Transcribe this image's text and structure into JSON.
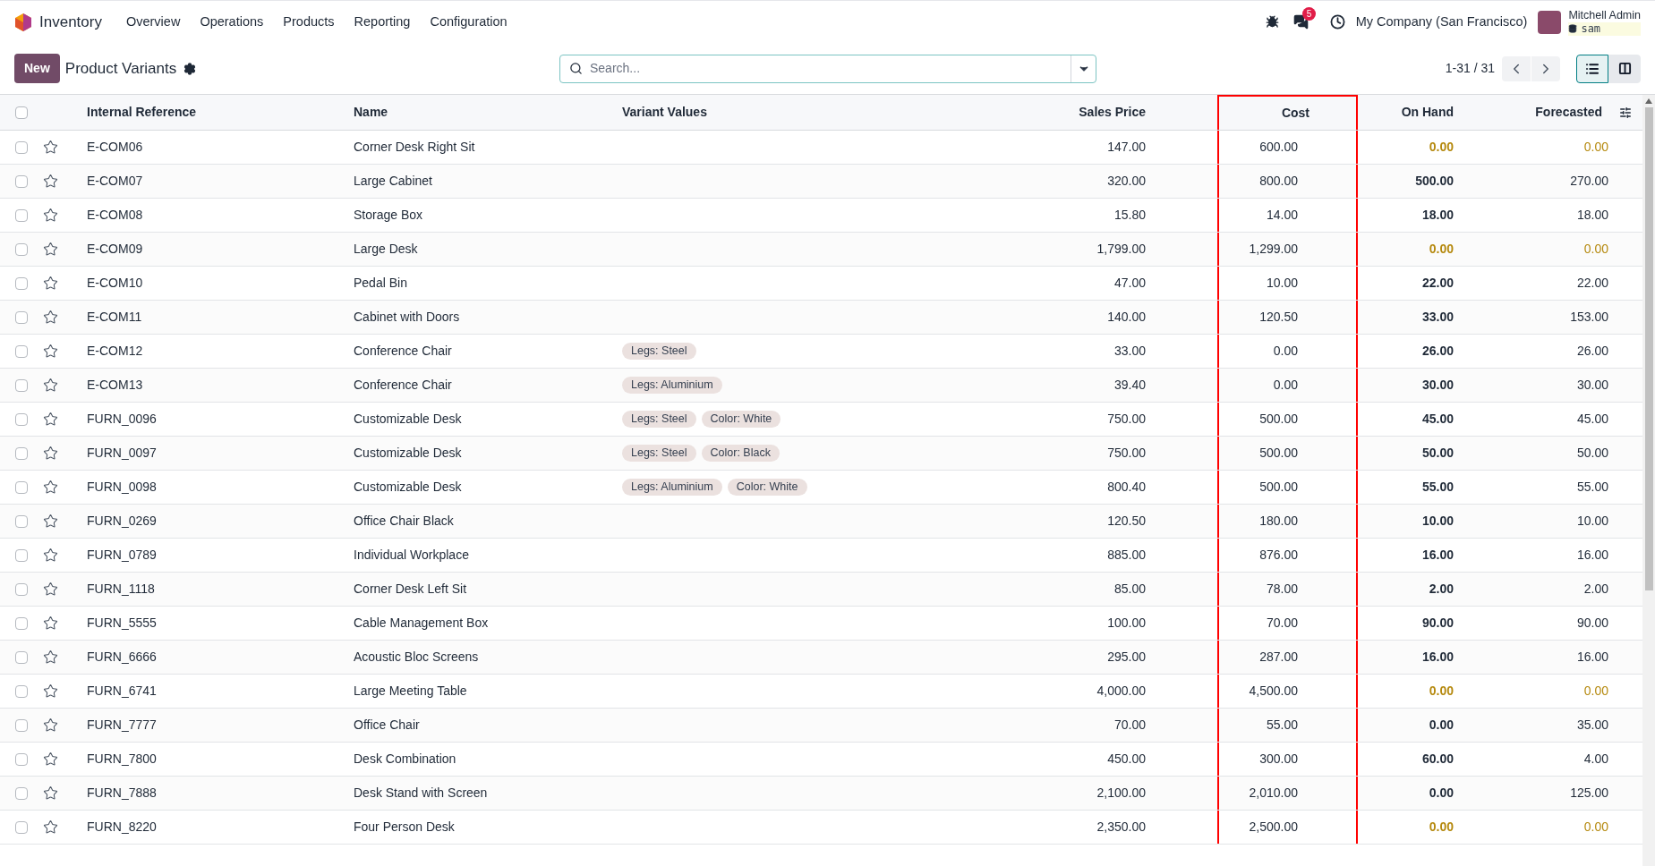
{
  "navbar": {
    "app": "Inventory",
    "menu": [
      "Overview",
      "Operations",
      "Products",
      "Reporting",
      "Configuration"
    ],
    "messages_badge": "5",
    "company": "My Company (San Francisco)",
    "user": "Mitchell Admin",
    "database": "sam"
  },
  "control_panel": {
    "new_button": "New",
    "title": "Product Variants",
    "search": {
      "placeholder": "Search..."
    },
    "pager": "1-31 / 31",
    "views": [
      {
        "kind": "list",
        "selected": true
      },
      {
        "kind": "kanban",
        "selected": false
      }
    ]
  },
  "table": {
    "select_all_checked": false,
    "columns": [
      {
        "label": "Internal Reference",
        "highlighted": false
      },
      {
        "label": "Name",
        "highlighted": false
      },
      {
        "label": "Variant Values",
        "highlighted": false
      },
      {
        "label": "Sales Price",
        "highlighted": false
      },
      {
        "label": "Cost",
        "highlighted": true
      },
      {
        "label": "On Hand",
        "highlighted": false
      },
      {
        "label": "Forecasted",
        "highlighted": false
      }
    ],
    "rows": [
      {
        "checked": false,
        "ref": "E-COM06",
        "name": "Corner Desk Right Sit",
        "variants": [],
        "sales_price": "147.00",
        "cost": "600.00",
        "on_hand": "0.00",
        "forecasted": "0.00",
        "warning": true
      },
      {
        "checked": false,
        "ref": "E-COM07",
        "name": "Large Cabinet",
        "variants": [],
        "sales_price": "320.00",
        "cost": "800.00",
        "on_hand": "500.00",
        "forecasted": "270.00",
        "warning": false
      },
      {
        "checked": false,
        "ref": "E-COM08",
        "name": "Storage Box",
        "variants": [],
        "sales_price": "15.80",
        "cost": "14.00",
        "on_hand": "18.00",
        "forecasted": "18.00",
        "warning": false
      },
      {
        "checked": false,
        "ref": "E-COM09",
        "name": "Large Desk",
        "variants": [],
        "sales_price": "1,799.00",
        "cost": "1,299.00",
        "on_hand": "0.00",
        "forecasted": "0.00",
        "warning": true
      },
      {
        "checked": false,
        "ref": "E-COM10",
        "name": "Pedal Bin",
        "variants": [],
        "sales_price": "47.00",
        "cost": "10.00",
        "on_hand": "22.00",
        "forecasted": "22.00",
        "warning": false
      },
      {
        "checked": false,
        "ref": "E-COM11",
        "name": "Cabinet with Doors",
        "variants": [],
        "sales_price": "140.00",
        "cost": "120.50",
        "on_hand": "33.00",
        "forecasted": "153.00",
        "warning": false
      },
      {
        "checked": false,
        "ref": "E-COM12",
        "name": "Conference Chair",
        "variants": [
          "Legs: Steel"
        ],
        "sales_price": "33.00",
        "cost": "0.00",
        "on_hand": "26.00",
        "forecasted": "26.00",
        "warning": false
      },
      {
        "checked": false,
        "ref": "E-COM13",
        "name": "Conference Chair",
        "variants": [
          "Legs: Aluminium"
        ],
        "sales_price": "39.40",
        "cost": "0.00",
        "on_hand": "30.00",
        "forecasted": "30.00",
        "warning": false
      },
      {
        "checked": false,
        "ref": "FURN_0096",
        "name": "Customizable Desk",
        "variants": [
          "Legs: Steel",
          "Color: White"
        ],
        "sales_price": "750.00",
        "cost": "500.00",
        "on_hand": "45.00",
        "forecasted": "45.00",
        "warning": false
      },
      {
        "checked": false,
        "ref": "FURN_0097",
        "name": "Customizable Desk",
        "variants": [
          "Legs: Steel",
          "Color: Black"
        ],
        "sales_price": "750.00",
        "cost": "500.00",
        "on_hand": "50.00",
        "forecasted": "50.00",
        "warning": false
      },
      {
        "checked": false,
        "ref": "FURN_0098",
        "name": "Customizable Desk",
        "variants": [
          "Legs: Aluminium",
          "Color: White"
        ],
        "sales_price": "800.40",
        "cost": "500.00",
        "on_hand": "55.00",
        "forecasted": "55.00",
        "warning": false
      },
      {
        "checked": false,
        "ref": "FURN_0269",
        "name": "Office Chair Black",
        "variants": [],
        "sales_price": "120.50",
        "cost": "180.00",
        "on_hand": "10.00",
        "forecasted": "10.00",
        "warning": false
      },
      {
        "checked": false,
        "ref": "FURN_0789",
        "name": "Individual Workplace",
        "variants": [],
        "sales_price": "885.00",
        "cost": "876.00",
        "on_hand": "16.00",
        "forecasted": "16.00",
        "warning": false
      },
      {
        "checked": false,
        "ref": "FURN_1118",
        "name": "Corner Desk Left Sit",
        "variants": [],
        "sales_price": "85.00",
        "cost": "78.00",
        "on_hand": "2.00",
        "forecasted": "2.00",
        "warning": false
      },
      {
        "checked": false,
        "ref": "FURN_5555",
        "name": "Cable Management Box",
        "variants": [],
        "sales_price": "100.00",
        "cost": "70.00",
        "on_hand": "90.00",
        "forecasted": "90.00",
        "warning": false
      },
      {
        "checked": false,
        "ref": "FURN_6666",
        "name": "Acoustic Bloc Screens",
        "variants": [],
        "sales_price": "295.00",
        "cost": "287.00",
        "on_hand": "16.00",
        "forecasted": "16.00",
        "warning": false
      },
      {
        "checked": false,
        "ref": "FURN_6741",
        "name": "Large Meeting Table",
        "variants": [],
        "sales_price": "4,000.00",
        "cost": "4,500.00",
        "on_hand": "0.00",
        "forecasted": "0.00",
        "warning": true
      },
      {
        "checked": false,
        "ref": "FURN_7777",
        "name": "Office Chair",
        "variants": [],
        "sales_price": "70.00",
        "cost": "55.00",
        "on_hand": "0.00",
        "forecasted": "35.00",
        "warning": false
      },
      {
        "checked": false,
        "ref": "FURN_7800",
        "name": "Desk Combination",
        "variants": [],
        "sales_price": "450.00",
        "cost": "300.00",
        "on_hand": "60.00",
        "forecasted": "4.00",
        "warning": false
      },
      {
        "checked": false,
        "ref": "FURN_7888",
        "name": "Desk Stand with Screen",
        "variants": [],
        "sales_price": "2,100.00",
        "cost": "2,010.00",
        "on_hand": "0.00",
        "forecasted": "125.00",
        "warning": false
      },
      {
        "checked": false,
        "ref": "FURN_8220",
        "name": "Four Person Desk",
        "variants": [],
        "sales_price": "2,350.00",
        "cost": "2,500.00",
        "on_hand": "0.00",
        "forecasted": "0.00",
        "warning": true
      }
    ]
  }
}
